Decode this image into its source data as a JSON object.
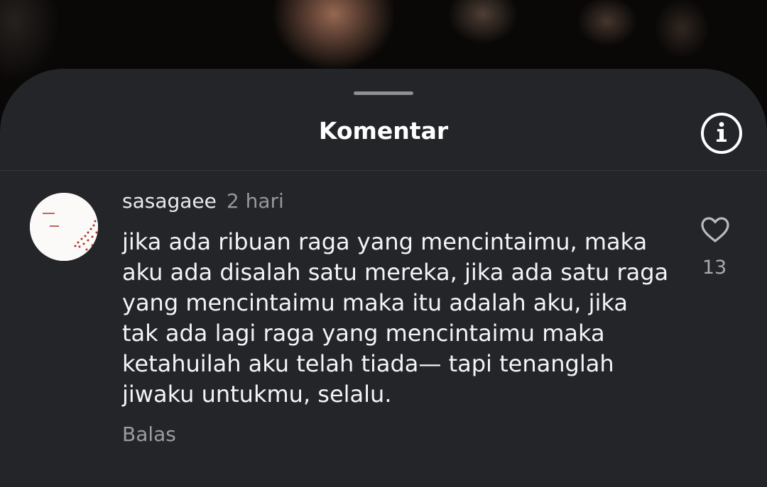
{
  "sheet": {
    "title": "Komentar",
    "info_icon": "info-circle-icon"
  },
  "comment": {
    "username": "sasagaee",
    "time": "2 hari",
    "text": "jika ada ribuan raga yang mencintaimu, maka\naku ada disalah satu mereka, jika ada satu raga\nyang mencintaimu maka itu adalah aku, jika\ntak ada lagi raga yang mencintaimu maka\nketahuilah aku telah tiada— tapi tenanglah\njiwaku untukmu, selalu.",
    "reply_label": "Balas",
    "like_icon": "heart-outline-icon",
    "like_count": "13"
  },
  "colors": {
    "sheet_bg": "#232529",
    "text_primary": "#f3f4f5",
    "text_secondary": "#95989d",
    "avatar_accent": "#b3302a"
  }
}
